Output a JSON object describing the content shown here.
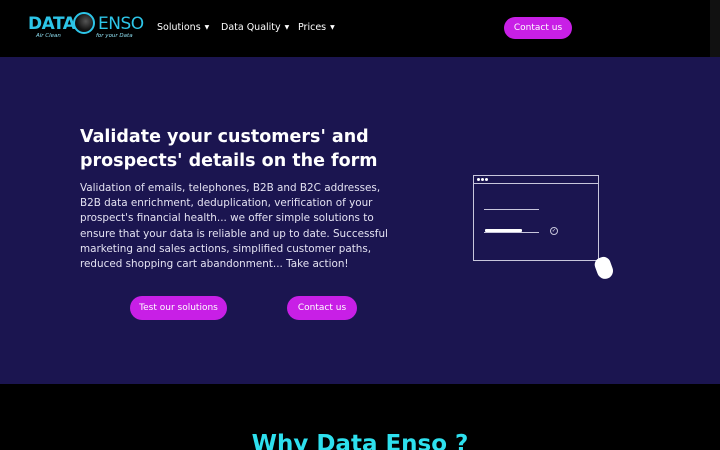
{
  "logo": {
    "word_left": "DATA",
    "word_right": "ENSO",
    "tagline_left": "Air Clean",
    "tagline_right": "for your Data"
  },
  "nav": {
    "solutions": "Solutions",
    "data_quality": "Data Quality",
    "prices": "Prices"
  },
  "header": {
    "contact_label": "Contact us"
  },
  "hero": {
    "title": "Validate your customers' and prospects' details on the form",
    "description": "Validation of emails, telephones, B2B and B2C addresses, B2B data enrichment, deduplication, verification of your prospect's financial health... we offer simple solutions to ensure that your data is reliable and up to date. Successful marketing and sales actions, simplified customer paths, reduced shopping cart abandonment... Take action!",
    "test_label": "Test our solutions",
    "contact_label": "Contact us"
  },
  "why": {
    "title": "Why Data Enso ?"
  },
  "colors": {
    "accent": "#c81fe6",
    "hero_bg": "#1b1550",
    "brand_cyan": "#2dc5e8"
  }
}
